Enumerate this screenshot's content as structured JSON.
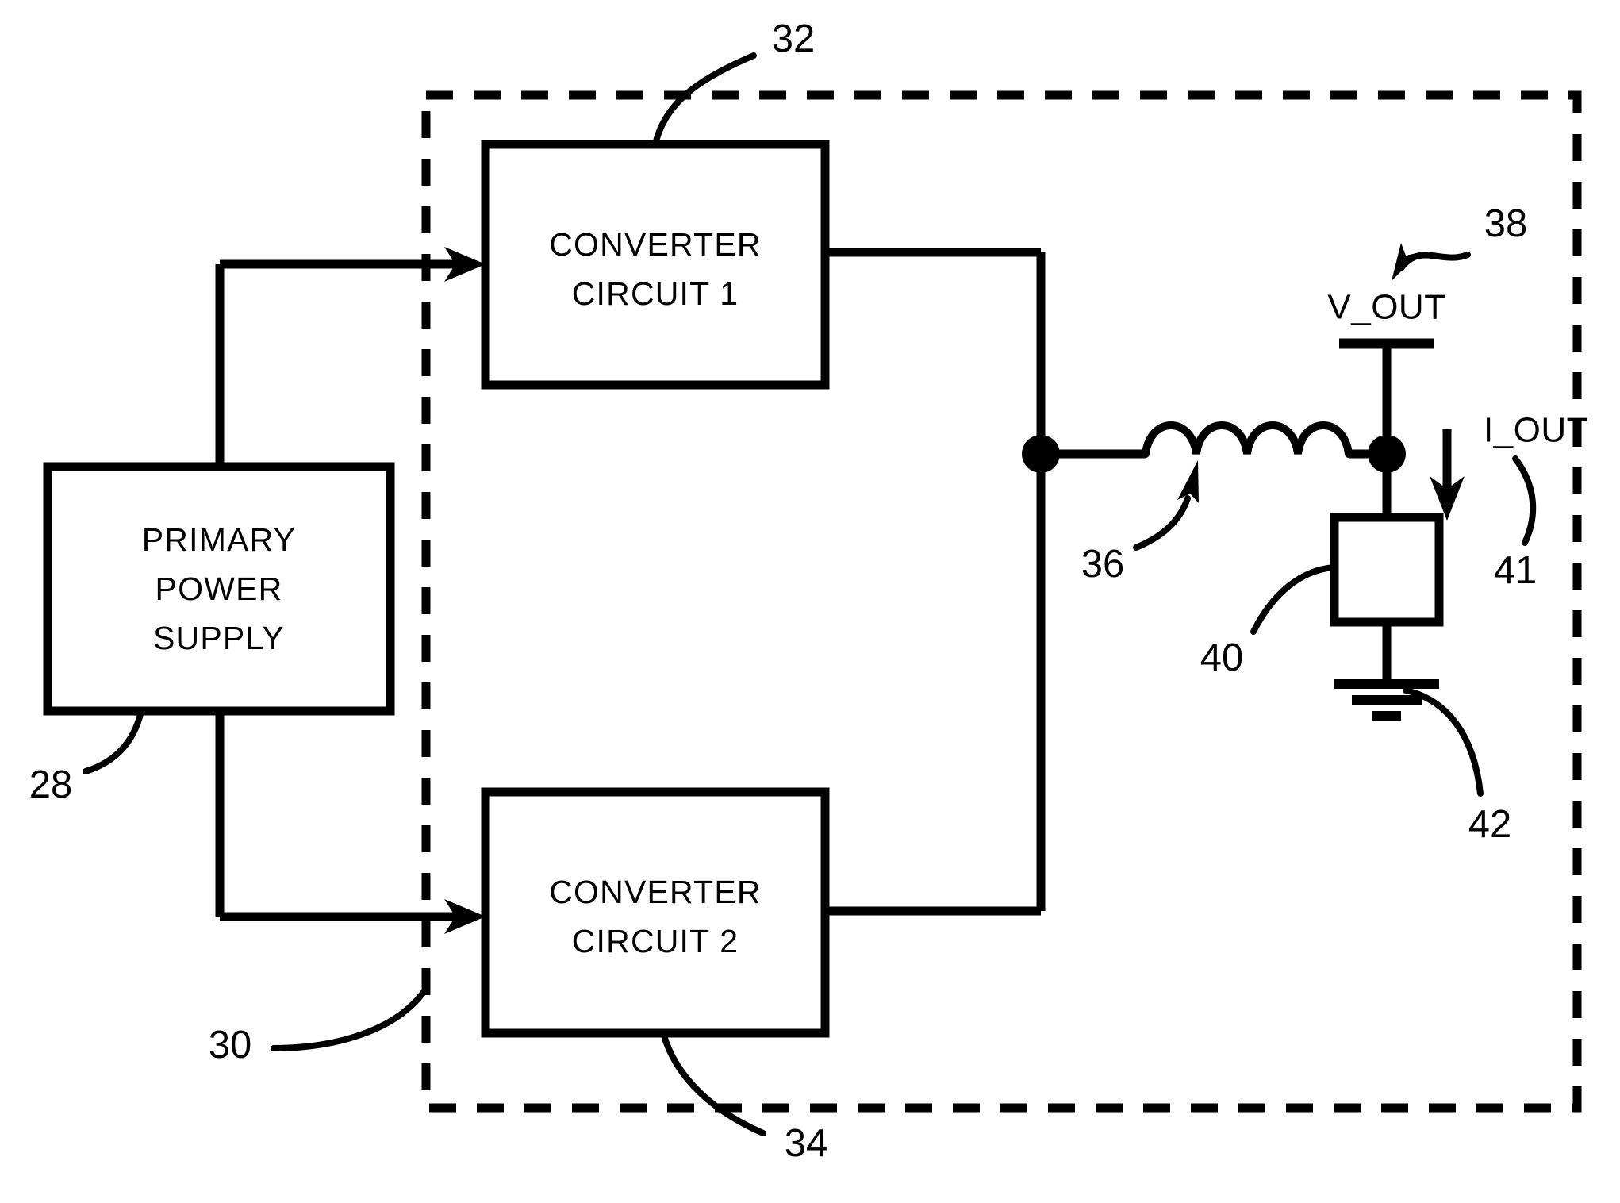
{
  "figure": {
    "type": "patent-block-diagram",
    "background_color": "#ffffff",
    "line_color": "#000000"
  },
  "blocks": {
    "power_supply": {
      "line1": "PRIMARY",
      "line2": "POWER",
      "line3": "SUPPLY"
    },
    "converter1": {
      "line1": "CONVERTER",
      "line2": "CIRCUIT 1"
    },
    "converter2": {
      "line1": "CONVERTER",
      "line2": "CIRCUIT 2"
    }
  },
  "signals": {
    "v_out": "V_OUT",
    "i_out": "I_OUT"
  },
  "reference_numerals": {
    "power_supply": "28",
    "dashed_boundary": "30",
    "converter1": "32",
    "converter2": "34",
    "inductor": "36",
    "output_terminal": "38",
    "load_resistor": "40",
    "output_current": "41",
    "ground": "42"
  }
}
